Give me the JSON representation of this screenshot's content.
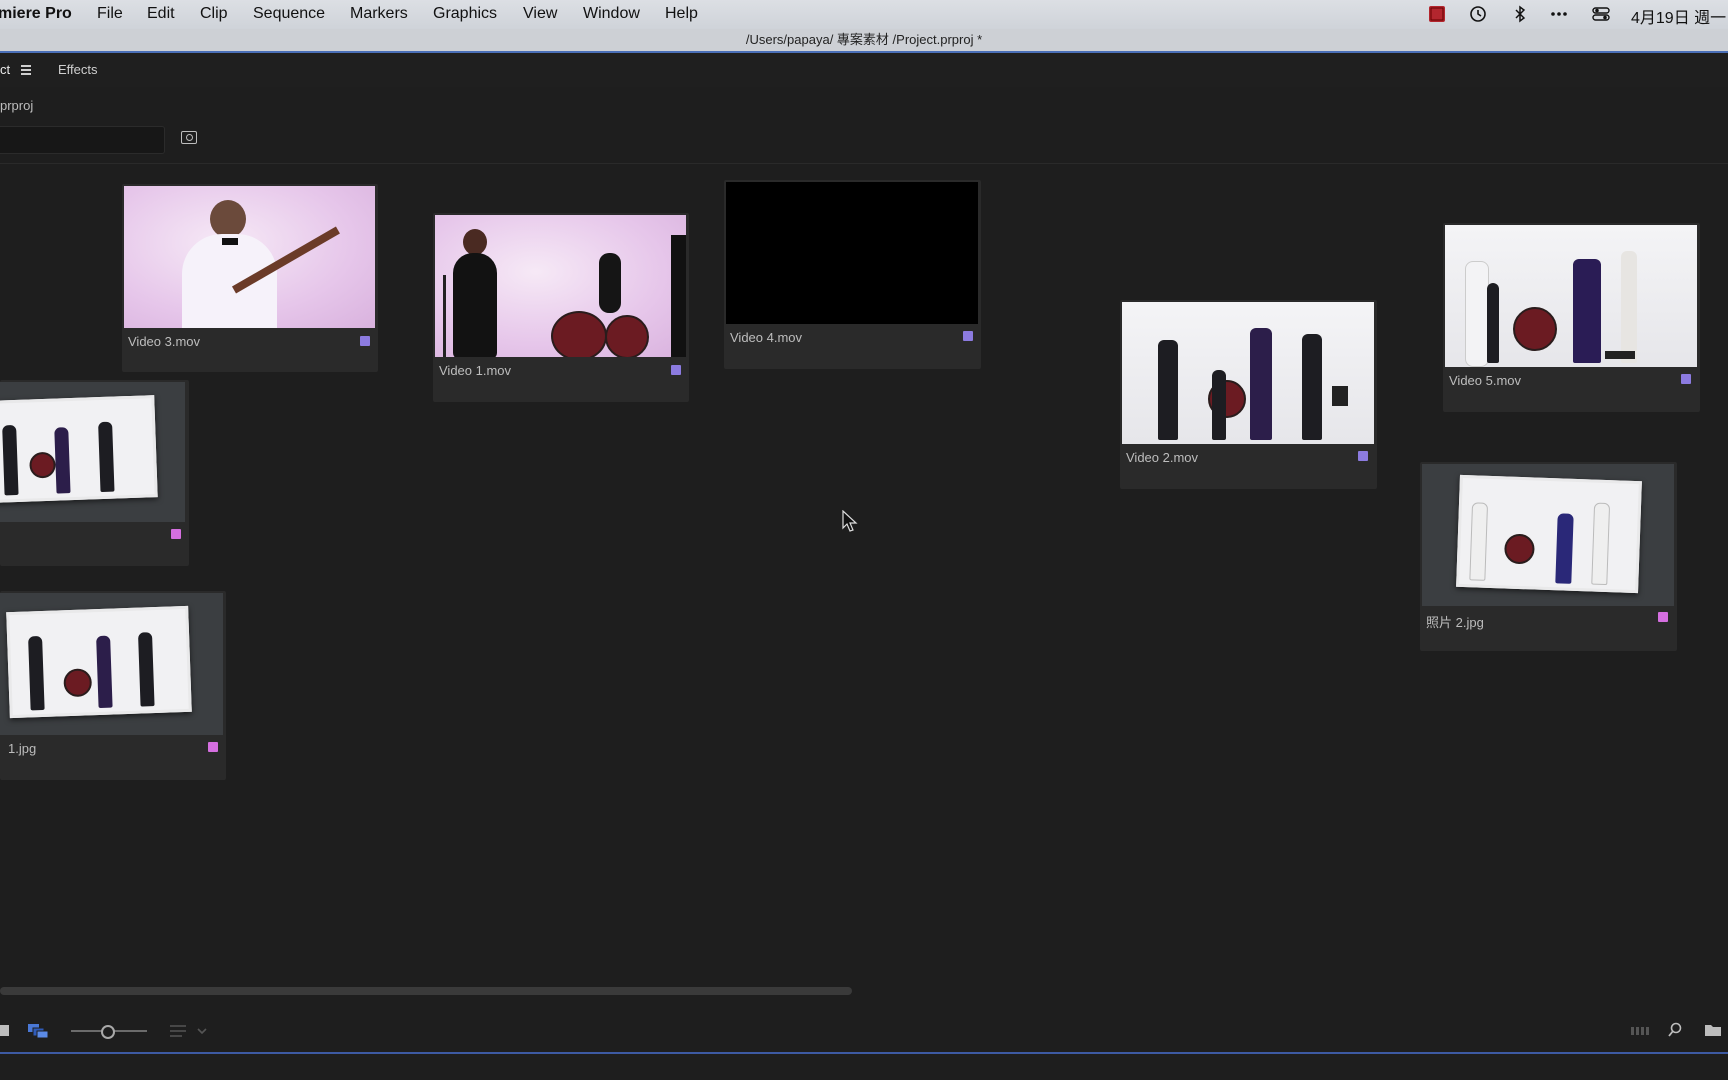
{
  "menubar": {
    "app_name": "miere Pro",
    "items": [
      "File",
      "Edit",
      "Clip",
      "Sequence",
      "Markers",
      "Graphics",
      "View",
      "Window",
      "Help"
    ],
    "datetime": "4月19日 週一",
    "tray_icons": [
      "screen-recorder-icon",
      "history-icon",
      "bluetooth-icon",
      "more-icon",
      "control-center-icon"
    ]
  },
  "titlebar": {
    "path": "/Users/papaya/ 專案素材 /Project.prproj *"
  },
  "panel": {
    "tab_project": "ct",
    "tab_effects": "Effects",
    "project_file": "prproj",
    "search_placeholder": ""
  },
  "clips": [
    {
      "name": "Video 3.mov",
      "color": "#8c7be0"
    },
    {
      "name": "Video 1.mov",
      "color": "#8c7be0"
    },
    {
      "name": "Video 4.mov",
      "color": "#8c7be0"
    },
    {
      "name": "Video 2.mov",
      "color": "#8c7be0"
    },
    {
      "name": "Video 5.mov",
      "color": "#8c7be0"
    },
    {
      "name": "",
      "color": "#d56fe0"
    },
    {
      "name": "照片 2.jpg",
      "color": "#d56fe0"
    },
    {
      "name": "1.jpg",
      "color": "#d56fe0"
    }
  ],
  "colors": {
    "label_violet": "#8c7be0",
    "label_magenta": "#d56fe0",
    "accent": "#3d5aa3"
  }
}
